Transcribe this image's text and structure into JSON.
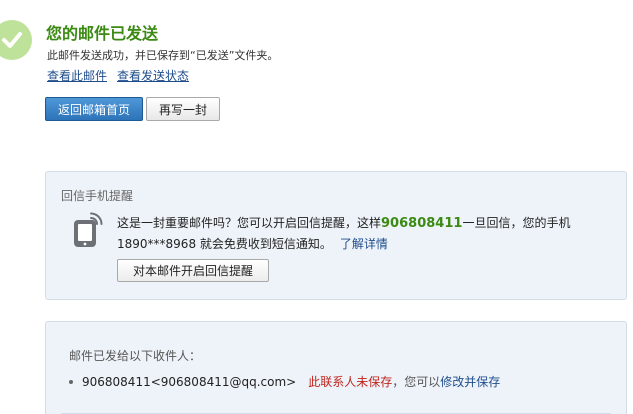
{
  "status": {
    "title": "您的邮件已发送",
    "subtitle": "此邮件发送成功，并已保存到“已发送”文件夹。",
    "links": [
      "查看此邮件",
      "查看发送状态"
    ],
    "icon": "check-circle-icon",
    "accent_color": "#3b8a13"
  },
  "actions": {
    "back_label": "返回邮箱首页",
    "compose_label": "再写一封"
  },
  "reminder": {
    "title": "回信手机提醒",
    "icon": "mobile-phone-icon",
    "text_before": "这是一封重要邮件吗？您可以开启回信提醒，这样",
    "number": "906808411",
    "text_after": "一旦回信，您的手机1890***8968 就会免费收到短信通知。",
    "details_link": "了解详情",
    "enable_button": "对本邮件开启回信提醒"
  },
  "recipients": {
    "title": "邮件已发给以下收件人：",
    "items": [
      {
        "address": "906808411<906808411@qq.com>",
        "status": "此联系人未保存",
        "hint": "，您可以",
        "action": "修改并保存"
      }
    ]
  }
}
